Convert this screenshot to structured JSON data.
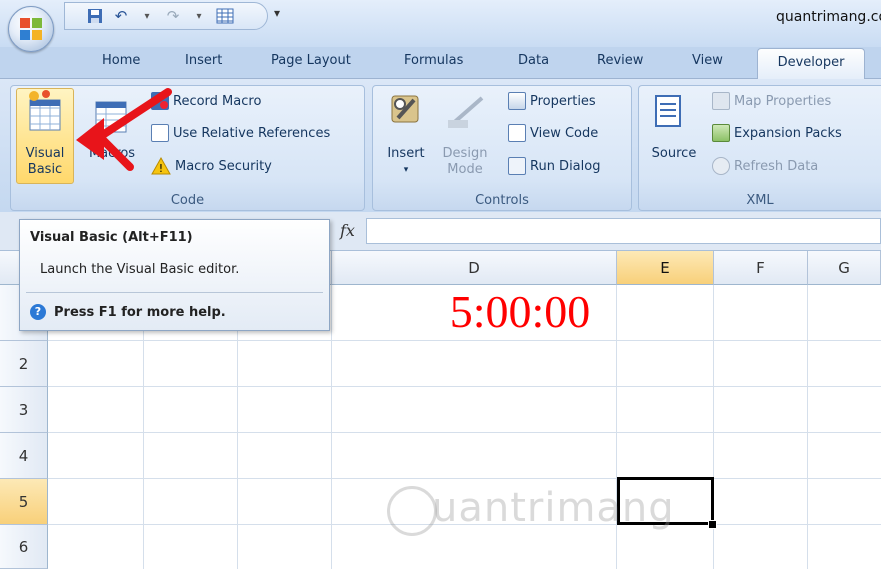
{
  "window": {
    "title": "quantrimang.co"
  },
  "tabs": [
    "Home",
    "Insert",
    "Page Layout",
    "Formulas",
    "Data",
    "Review",
    "View",
    "Developer"
  ],
  "active_tab": "Developer",
  "ribbon": {
    "code": {
      "label": "Code",
      "visual_basic_line1": "Visual",
      "visual_basic_line2": "Basic",
      "macros": "Macros",
      "record_macro": "Record Macro",
      "use_relative": "Use Relative References",
      "macro_security": "Macro Security"
    },
    "controls": {
      "label": "Controls",
      "insert": "Insert",
      "design_mode_line1": "Design",
      "design_mode_line2": "Mode",
      "properties": "Properties",
      "view_code": "View Code",
      "run_dialog": "Run Dialog"
    },
    "xml": {
      "label": "XML",
      "source": "Source",
      "map_properties": "Map Properties",
      "expansion_packs": "Expansion Packs",
      "refresh_data": "Refresh Data"
    }
  },
  "formula_bar": {
    "fx": "fx"
  },
  "grid": {
    "columns": [
      "D",
      "E",
      "F",
      "G"
    ],
    "selected_column": "E",
    "rows": [
      "2",
      "3",
      "4",
      "5",
      "6"
    ],
    "selected_row": "5",
    "d1_value": "5:00:00",
    "d1_color": "#ff0000"
  },
  "tooltip": {
    "title": "Visual Basic (Alt+F11)",
    "description": "Launch the Visual Basic editor.",
    "help": "Press F1 for more help."
  },
  "watermark": "uantrimang"
}
